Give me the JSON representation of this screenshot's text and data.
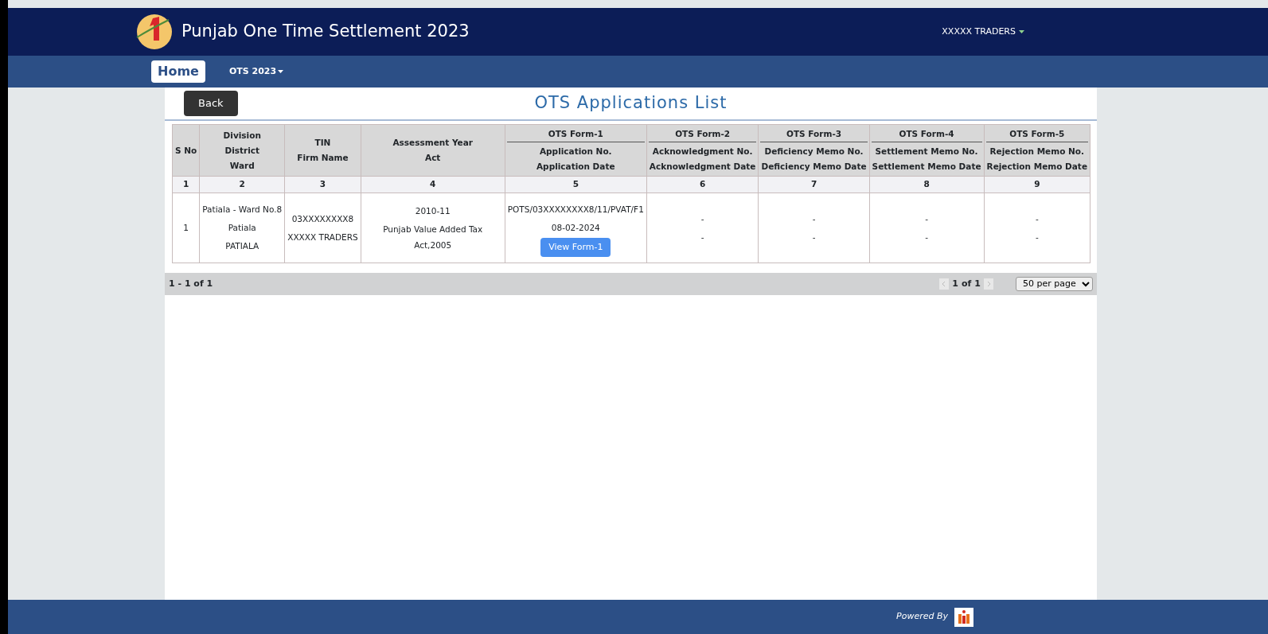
{
  "header": {
    "title": "Punjab One Time Settlement 2023",
    "user_menu": "XXXXX TRADERS"
  },
  "nav": [
    {
      "label": "Home",
      "selected": true,
      "dropdown": false
    },
    {
      "label": "OTS 2023",
      "selected": false,
      "dropdown": true
    }
  ],
  "page": {
    "back_button": "Back",
    "title": "OTS Applications List"
  },
  "table": {
    "columns": [
      {
        "lines": [
          "S No"
        ],
        "number": "1"
      },
      {
        "lines": [
          "Division",
          "District",
          "Ward"
        ],
        "number": "2"
      },
      {
        "lines": [
          "TIN",
          "Firm Name"
        ],
        "number": "3"
      },
      {
        "lines": [
          "Assessment Year",
          "Act"
        ],
        "number": "4"
      },
      {
        "group": "OTS Form-1",
        "lines": [
          "Application No.",
          "Application Date"
        ],
        "number": "5"
      },
      {
        "group": "OTS Form-2",
        "lines": [
          "Acknowledgment No.",
          "Acknowledgment Date"
        ],
        "number": "6"
      },
      {
        "group": "OTS Form-3",
        "lines": [
          "Deficiency Memo No.",
          "Deficiency Memo Date"
        ],
        "number": "7"
      },
      {
        "group": "OTS Form-4",
        "lines": [
          "Settlement Memo No.",
          "Settlement Memo Date"
        ],
        "number": "8"
      },
      {
        "group": "OTS Form-5",
        "lines": [
          "Rejection Memo No.",
          "Rejection Memo Date"
        ],
        "number": "9"
      }
    ],
    "rows": [
      {
        "cells": [
          {
            "lines": [
              "1"
            ]
          },
          {
            "lines": [
              "Patiala - Ward No.8",
              "Patiala",
              "PATIALA"
            ]
          },
          {
            "lines": [
              "03XXXXXXXX8",
              "XXXXX TRADERS"
            ]
          },
          {
            "lines": [
              "2010-11",
              "Punjab Value Added Tax Act,2005"
            ]
          },
          {
            "lines": [
              "POTS/03XXXXXXXX8/11/PVAT/F1",
              "08-02-2024"
            ],
            "button": "View Form-1"
          },
          {
            "lines": [
              "-",
              "-"
            ]
          },
          {
            "lines": [
              "-",
              "-"
            ]
          },
          {
            "lines": [
              "-",
              "-"
            ]
          },
          {
            "lines": [
              "-",
              "-"
            ]
          }
        ]
      }
    ]
  },
  "pager": {
    "summary": "1 - 1 of 1",
    "page": "1",
    "of": "of",
    "pages": "1",
    "page_size": "50 per page"
  },
  "footer": {
    "powered_by": "Powered By"
  }
}
